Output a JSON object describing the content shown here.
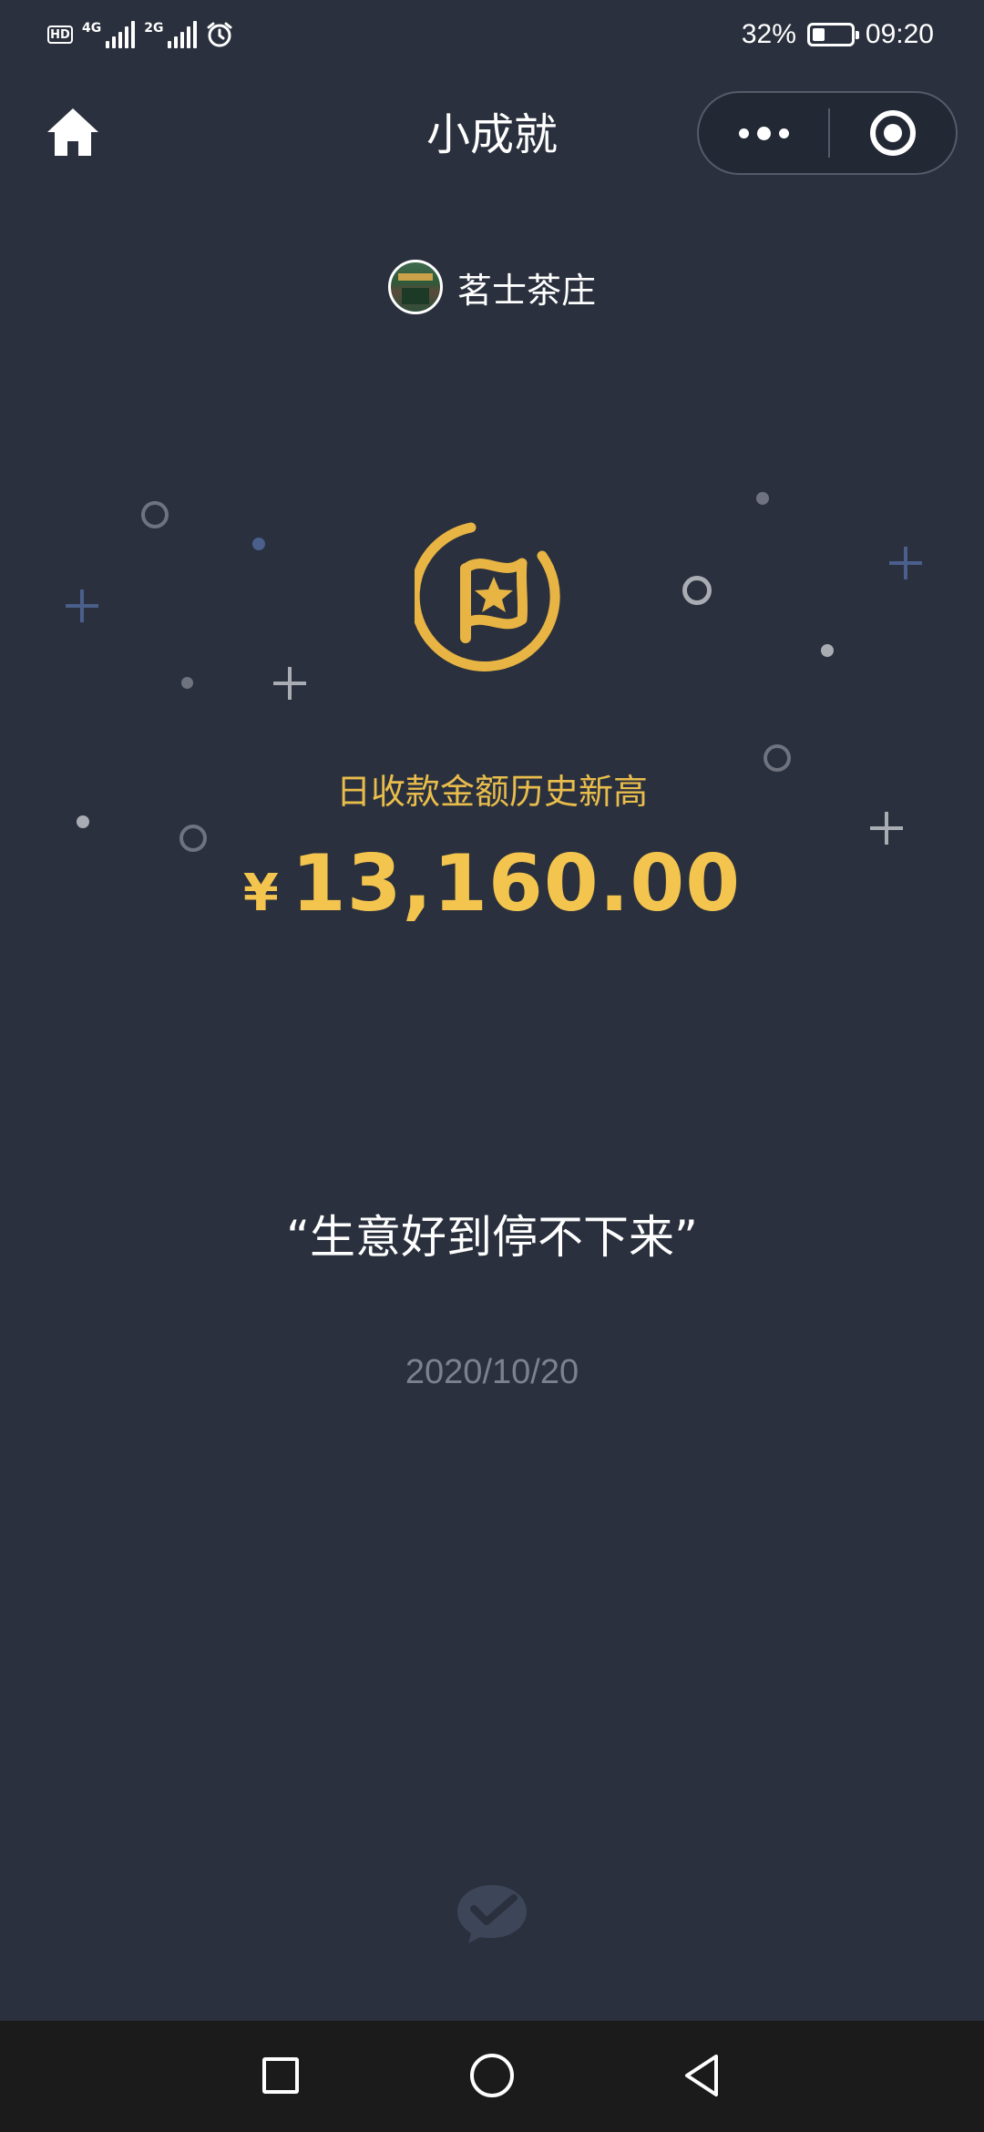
{
  "status_bar": {
    "hd_label": "HD",
    "network1_label": "4G",
    "network2_label": "2G",
    "battery_percent": "32%",
    "battery_level": 0.32,
    "time": "09:20",
    "icons": [
      "hd-icon",
      "signal-icon",
      "signal-icon",
      "alarm-icon",
      "battery-icon"
    ]
  },
  "nav": {
    "title": "小成就",
    "home_icon": "home-icon",
    "more_icon": "more-dots-icon",
    "close_icon": "target-icon"
  },
  "store": {
    "name": "茗士茶庄",
    "avatar_icon": "store-avatar"
  },
  "achievement": {
    "badge_icon": "flag-star-badge-icon",
    "title": "日收款金额历史新高",
    "currency_symbol": "¥",
    "amount": "13,160.00",
    "quote": "“生意好到停不下来”",
    "date": "2020/10/20"
  },
  "footer": {
    "logo_icon": "wechat-pay-logo-icon"
  },
  "android_nav": {
    "icons": [
      "recent-apps-icon",
      "home-circle-icon",
      "back-icon"
    ]
  },
  "colors": {
    "background": "#2a303d",
    "gold": "#f4c54e",
    "gold_badge": "#e8b443",
    "muted": "#7b8190",
    "accent_blue": "#4a5f8c"
  }
}
